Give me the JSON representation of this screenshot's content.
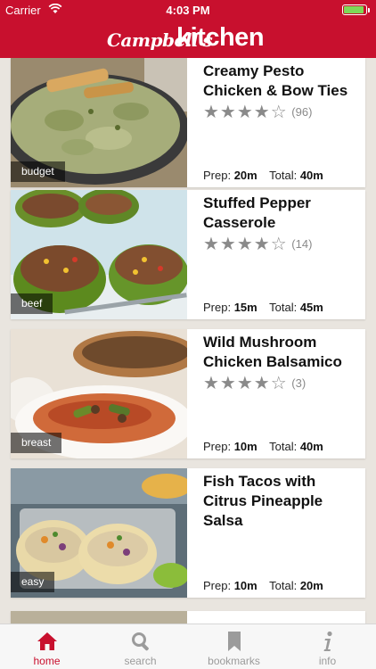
{
  "status": {
    "carrier": "Carrier",
    "time": "4:03 PM"
  },
  "header": {
    "brand": "Campbell's",
    "section": "kitchen"
  },
  "recipes": [
    {
      "title": "Creamy Pesto Chicken & Bow Ties",
      "tag": "budget",
      "stars": 4,
      "rating_count": "(96)",
      "prep_label": "Prep:",
      "prep": "20m",
      "total_label": "Total:",
      "total": "40m"
    },
    {
      "title": "Stuffed Pepper Casserole",
      "tag": "beef",
      "stars": 4,
      "rating_count": "(14)",
      "prep_label": "Prep:",
      "prep": "15m",
      "total_label": "Total:",
      "total": "45m"
    },
    {
      "title": "Wild Mushroom Chicken Balsamico",
      "tag": "breast",
      "stars": 4,
      "rating_count": "(3)",
      "prep_label": "Prep:",
      "prep": "10m",
      "total_label": "Total:",
      "total": "40m"
    },
    {
      "title": "Fish Tacos with Citrus Pineapple Salsa",
      "tag": "easy",
      "prep_label": "Prep:",
      "prep": "10m",
      "total_label": "Total:",
      "total": "20m"
    }
  ],
  "tabs": [
    {
      "label": "home",
      "icon": "home-icon",
      "active": true
    },
    {
      "label": "search",
      "icon": "search-icon",
      "active": false
    },
    {
      "label": "bookmarks",
      "icon": "bookmark-icon",
      "active": false
    },
    {
      "label": "info",
      "icon": "info-icon",
      "active": false
    }
  ],
  "colors": {
    "brand_red": "#c8102e",
    "star_gray": "#8a8a8a",
    "tab_inactive": "#9b9b9b"
  }
}
